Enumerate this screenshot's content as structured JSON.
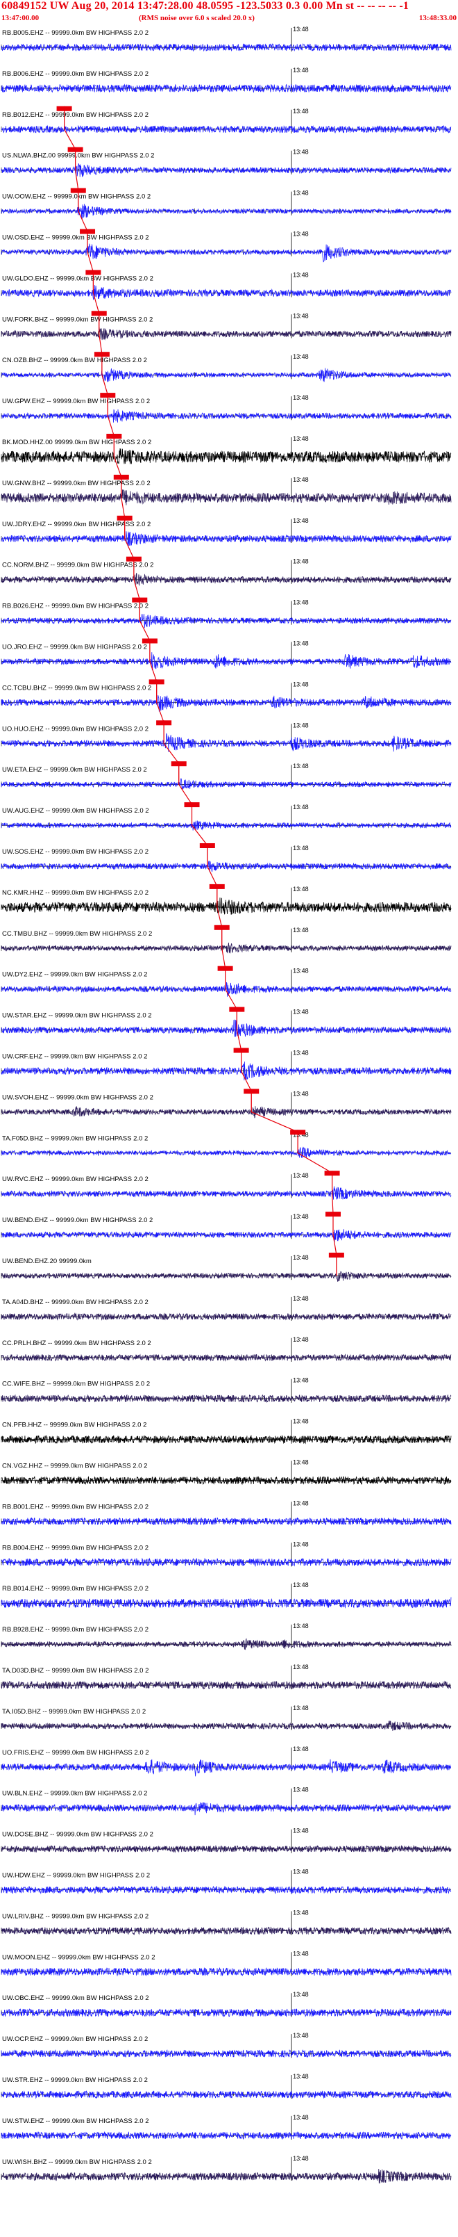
{
  "header": {
    "title": "60849152 UW Aug 20, 2014 13:47:28.00    48.0595 -123.5033  0.3 0.00 Mn st -- -- -- -- -1",
    "start_time": "13:47:00.00",
    "end_time": "13:48:33.00",
    "note": "(RMS noise over 6.0 s scaled 20.0 x)"
  },
  "tick_label": "13:48",
  "colors": {
    "header_text": "#e8000a",
    "pick": "#e8000a",
    "blue_trace": "#1a1aff",
    "dark_trace": "#2a1a5a",
    "black_trace": "#000000",
    "axis": "#000000"
  },
  "chart_data": {
    "type": "line",
    "title": "60849152 UW Aug 20, 2014 13:47:28.00    48.0595 -123.5033  0.3 0.00 Mn st -- -- -- -- -1",
    "x_unit": "time",
    "x_start": "13:47:00.00",
    "x_end": "13:48:33.00",
    "x_range_seconds": [
      0,
      93
    ],
    "tick_seconds": [
      60
    ],
    "grid": false,
    "channels": [
      {
        "label": "RB.B005.EHZ -- 99999.0km BW  HIGHPASS  2.0  2",
        "color": "blue",
        "pick_s": null,
        "amp": 0.55,
        "events": []
      },
      {
        "label": "RB.B006.EHZ -- 99999.0km BW  HIGHPASS  2.0  2",
        "color": "blue",
        "pick_s": null,
        "amp": 0.6,
        "events": []
      },
      {
        "label": "RB.B012.EHZ -- 99999.0km BW  HIGHPASS  2.0  2",
        "color": "blue",
        "pick_s": 13.0,
        "amp": 0.55,
        "events": []
      },
      {
        "label": "US.NLWA.BHZ.00 99999.0km BW  HIGHPASS  2.0  2",
        "color": "blue",
        "pick_s": 15.3,
        "amp": 0.45,
        "events": [
          [
            15.3,
            1.0
          ]
        ]
      },
      {
        "label": "UW.OOW.EHZ -- 99999.0km BW  HIGHPASS  2.0  2",
        "color": "blue",
        "pick_s": 15.9,
        "amp": 0.35,
        "events": [
          [
            15.9,
            1.2
          ]
        ]
      },
      {
        "label": "UW.OSD.EHZ -- 99999.0km BW  HIGHPASS  2.0  2",
        "color": "blue",
        "pick_s": 17.8,
        "amp": 0.4,
        "events": [
          [
            17.8,
            1.3
          ],
          [
            66.0,
            1.4
          ]
        ]
      },
      {
        "label": "UW.GLDO.EHZ -- 99999.0km BW  HIGHPASS  2.0  2",
        "color": "blue",
        "pick_s": 19.0,
        "amp": 0.55,
        "events": [
          [
            19.0,
            0.8
          ]
        ]
      },
      {
        "label": "UW.FORK.BHZ -- 99999.0km BW  HIGHPASS  2.0  2",
        "color": "dark",
        "pick_s": 20.2,
        "amp": 0.5,
        "events": [
          [
            20.2,
            0.6
          ]
        ]
      },
      {
        "label": "CN.OZB.BHZ -- 99999.0km BW  HIGHPASS  2.0  2",
        "color": "blue",
        "pick_s": 20.8,
        "amp": 0.35,
        "events": [
          [
            21.0,
            1.2
          ],
          [
            66.0,
            1.1
          ]
        ]
      },
      {
        "label": "UW.GPW.EHZ -- 99999.0km BW  HIGHPASS  2.0  2",
        "color": "blue",
        "pick_s": 22.0,
        "amp": 0.45,
        "events": [
          [
            22.5,
            1.0
          ]
        ]
      },
      {
        "label": "BK.MOD.HHZ.00 99999.0km BW  HIGHPASS  2.0  2",
        "color": "black",
        "pick_s": 23.3,
        "amp": 0.9,
        "events": [
          [
            24.0,
            0.6
          ]
        ]
      },
      {
        "label": "UW.GNW.BHZ -- 99999.0km BW  HIGHPASS  2.0  2",
        "color": "dark",
        "pick_s": 24.8,
        "amp": 0.75,
        "events": [
          [
            25.0,
            0.7
          ],
          [
            80.0,
            0.6
          ]
        ]
      },
      {
        "label": "UW.JDRY.EHZ -- 99999.0km BW  HIGHPASS  2.0  2",
        "color": "blue",
        "pick_s": 25.5,
        "amp": 0.55,
        "events": [
          [
            25.8,
            0.8
          ]
        ]
      },
      {
        "label": "CC.NORM.BHZ -- 99999.0km BW  HIGHPASS  2.0  2",
        "color": "dark",
        "pick_s": 27.4,
        "amp": 0.5,
        "events": [
          [
            27.6,
            0.6
          ]
        ]
      },
      {
        "label": "RB.B026.EHZ -- 99999.0km BW  HIGHPASS  2.0  2",
        "color": "blue",
        "pick_s": 28.6,
        "amp": 0.45,
        "events": [
          [
            29.0,
            0.9
          ]
        ]
      },
      {
        "label": "UO.JRO.EHZ -- 99999.0km BW  HIGHPASS  2.0  2",
        "color": "blue",
        "pick_s": 30.7,
        "amp": 0.45,
        "events": [
          [
            31.0,
            1.2
          ],
          [
            44.0,
            0.9
          ],
          [
            71.0,
            1.0
          ],
          [
            85.0,
            0.9
          ]
        ]
      },
      {
        "label": "CC.TCBU.BHZ -- 99999.0km BW  HIGHPASS  2.0  2",
        "color": "blue",
        "pick_s": 32.1,
        "amp": 0.5,
        "events": [
          [
            32.4,
            1.1
          ],
          [
            56.0,
            0.7
          ],
          [
            75.0,
            0.8
          ]
        ]
      },
      {
        "label": "UO.HUO.EHZ -- 99999.0km BW  HIGHPASS  2.0  2",
        "color": "blue",
        "pick_s": 33.6,
        "amp": 0.5,
        "events": [
          [
            34.0,
            1.2
          ],
          [
            60.0,
            0.8
          ],
          [
            81.0,
            0.9
          ]
        ]
      },
      {
        "label": "UW.ETA.EHZ -- 99999.0km BW  HIGHPASS  2.0  2",
        "color": "blue",
        "pick_s": 36.7,
        "amp": 0.4,
        "events": [
          [
            37.0,
            0.6
          ]
        ]
      },
      {
        "label": "UW.AUG.EHZ -- 99999.0km BW  HIGHPASS  2.0  2",
        "color": "blue",
        "pick_s": 39.4,
        "amp": 0.4,
        "events": [
          [
            39.6,
            0.5
          ]
        ]
      },
      {
        "label": "UW.SOS.EHZ -- 99999.0km BW  HIGHPASS  2.0  2",
        "color": "blue",
        "pick_s": 42.6,
        "amp": 0.45,
        "events": [
          [
            42.8,
            0.6
          ]
        ]
      },
      {
        "label": "NC.KMR.HHZ -- 99999.0km BW  HIGHPASS  2.0  2",
        "color": "black",
        "pick_s": 44.6,
        "amp": 0.8,
        "events": [
          [
            45.0,
            0.9
          ]
        ]
      },
      {
        "label": "CC.TMBU.BHZ -- 99999.0km BW  HIGHPASS  2.0  2",
        "color": "dark",
        "pick_s": 45.6,
        "amp": 0.4,
        "events": [
          [
            45.8,
            0.7
          ]
        ]
      },
      {
        "label": "UW.DY2.EHZ -- 99999.0km BW  HIGHPASS  2.0  2",
        "color": "blue",
        "pick_s": 46.3,
        "amp": 0.45,
        "events": [
          [
            46.5,
            1.0
          ]
        ]
      },
      {
        "label": "UW.STAR.EHZ -- 99999.0km BW  HIGHPASS  2.0  2",
        "color": "blue",
        "pick_s": 48.7,
        "amp": 0.5,
        "events": [
          [
            48.0,
            1.3
          ]
        ]
      },
      {
        "label": "UW.CRF.EHZ -- 99999.0km BW  HIGHPASS  2.0  2",
        "color": "blue",
        "pick_s": 49.6,
        "amp": 0.55,
        "events": [
          [
            50.0,
            1.1
          ]
        ]
      },
      {
        "label": "UW.SVOH.EHZ -- 99999.0km BW  HIGHPASS  2.0  2",
        "color": "dark",
        "pick_s": 51.7,
        "amp": 0.4,
        "events": [
          [
            15.0,
            0.6
          ],
          [
            52.0,
            0.7
          ]
        ]
      },
      {
        "label": "TA.F05D.BHZ -- 99999.0km BW  HIGHPASS  2.0  2",
        "color": "blue",
        "pick_s": 61.3,
        "amp": 0.35,
        "events": [
          [
            61.6,
            0.7
          ]
        ]
      },
      {
        "label": "UW.RVC.EHZ -- 99999.0km BW  HIGHPASS  2.0  2",
        "color": "blue",
        "pick_s": 68.4,
        "amp": 0.45,
        "events": [
          [
            68.6,
            0.9
          ]
        ]
      },
      {
        "label": "UW.BEND.EHZ -- 99999.0km BW  HIGHPASS  2.0  2",
        "color": "blue",
        "pick_s": 68.6,
        "amp": 0.45,
        "events": [
          [
            68.8,
            0.9
          ]
        ]
      },
      {
        "label": "UW.BEND.EHZ.20 99999.0km",
        "color": "dark",
        "pick_s": 69.3,
        "amp": 0.4,
        "events": [
          [
            69.5,
            0.6
          ]
        ]
      },
      {
        "label": "TA.A04D.BHZ -- 99999.0km BW  HIGHPASS  2.0  2",
        "color": "dark",
        "pick_s": null,
        "amp": 0.5,
        "events": []
      },
      {
        "label": "CC.PRLH.BHZ -- 99999.0km BW  HIGHPASS  2.0  2",
        "color": "dark",
        "pick_s": null,
        "amp": 0.5,
        "events": []
      },
      {
        "label": "CC.WIFE.BHZ -- 99999.0km BW  HIGHPASS  2.0  2",
        "color": "dark",
        "pick_s": null,
        "amp": 0.55,
        "events": []
      },
      {
        "label": "CN.PFB.HHZ -- 99999.0km BW  HIGHPASS  2.0  2",
        "color": "black",
        "pick_s": null,
        "amp": 0.6,
        "events": []
      },
      {
        "label": "CN.VGZ.HHZ -- 99999.0km BW  HIGHPASS  2.0  2",
        "color": "black",
        "pick_s": null,
        "amp": 0.6,
        "events": []
      },
      {
        "label": "RB.B001.EHZ -- 99999.0km BW  HIGHPASS  2.0  2",
        "color": "blue",
        "pick_s": null,
        "amp": 0.55,
        "events": []
      },
      {
        "label": "RB.B004.EHZ -- 99999.0km BW  HIGHPASS  2.0  2",
        "color": "blue",
        "pick_s": null,
        "amp": 0.6,
        "events": []
      },
      {
        "label": "RB.B014.EHZ -- 99999.0km BW  HIGHPASS  2.0  2",
        "color": "blue",
        "pick_s": null,
        "amp": 0.7,
        "events": [
          [
            93.0,
            0.8
          ]
        ]
      },
      {
        "label": "RB.B928.EHZ -- 99999.0km BW  HIGHPASS  2.0  2",
        "color": "dark",
        "pick_s": null,
        "amp": 0.4,
        "events": [
          [
            50.0,
            0.6
          ],
          [
            58.0,
            0.5
          ]
        ]
      },
      {
        "label": "TA.D03D.BHZ -- 99999.0km BW  HIGHPASS  2.0  2",
        "color": "dark",
        "pick_s": null,
        "amp": 0.6,
        "events": []
      },
      {
        "label": "TA.I05D.BHZ -- 99999.0km BW  HIGHPASS  2.0  2",
        "color": "dark",
        "pick_s": null,
        "amp": 0.45,
        "events": [
          [
            80.0,
            0.5
          ]
        ]
      },
      {
        "label": "UO.FRIS.EHZ -- 99999.0km BW  HIGHPASS  2.0  2",
        "color": "blue",
        "pick_s": null,
        "amp": 0.5,
        "events": [
          [
            30.0,
            1.1
          ],
          [
            40.0,
            1.0
          ],
          [
            68.0,
            0.8
          ],
          [
            79.0,
            0.8
          ]
        ]
      },
      {
        "label": "UW.BLN.EHZ -- 99999.0km BW  HIGHPASS  2.0  2",
        "color": "blue",
        "pick_s": null,
        "amp": 0.55,
        "events": [
          [
            40.0,
            0.7
          ]
        ]
      },
      {
        "label": "UW.DOSE.BHZ -- 99999.0km BW  HIGHPASS  2.0  2",
        "color": "dark",
        "pick_s": null,
        "amp": 0.5,
        "events": []
      },
      {
        "label": "UW.HDW.EHZ -- 99999.0km BW  HIGHPASS  2.0  2",
        "color": "blue",
        "pick_s": null,
        "amp": 0.55,
        "events": []
      },
      {
        "label": "UW.LRIV.BHZ -- 99999.0km BW  HIGHPASS  2.0  2",
        "color": "dark",
        "pick_s": null,
        "amp": 0.55,
        "events": []
      },
      {
        "label": "UW.MOON.EHZ -- 99999.0km BW  HIGHPASS  2.0  2",
        "color": "blue",
        "pick_s": null,
        "amp": 0.6,
        "events": []
      },
      {
        "label": "UW.OBC.EHZ -- 99999.0km BW  HIGHPASS  2.0  2",
        "color": "blue",
        "pick_s": null,
        "amp": 0.6,
        "events": []
      },
      {
        "label": "UW.OCP.EHZ -- 99999.0km BW  HIGHPASS  2.0  2",
        "color": "blue",
        "pick_s": null,
        "amp": 0.55,
        "events": []
      },
      {
        "label": "UW.STR.EHZ -- 99999.0km BW  HIGHPASS  2.0  2",
        "color": "blue",
        "pick_s": null,
        "amp": 0.55,
        "events": []
      },
      {
        "label": "UW.STW.EHZ -- 99999.0km BW  HIGHPASS  2.0  2",
        "color": "blue",
        "pick_s": null,
        "amp": 0.55,
        "events": []
      },
      {
        "label": "UW.WISH.BHZ -- 99999.0km BW  HIGHPASS  2.0  2",
        "color": "dark",
        "pick_s": null,
        "amp": 0.6,
        "events": [
          [
            78.0,
            0.7
          ]
        ]
      }
    ]
  }
}
